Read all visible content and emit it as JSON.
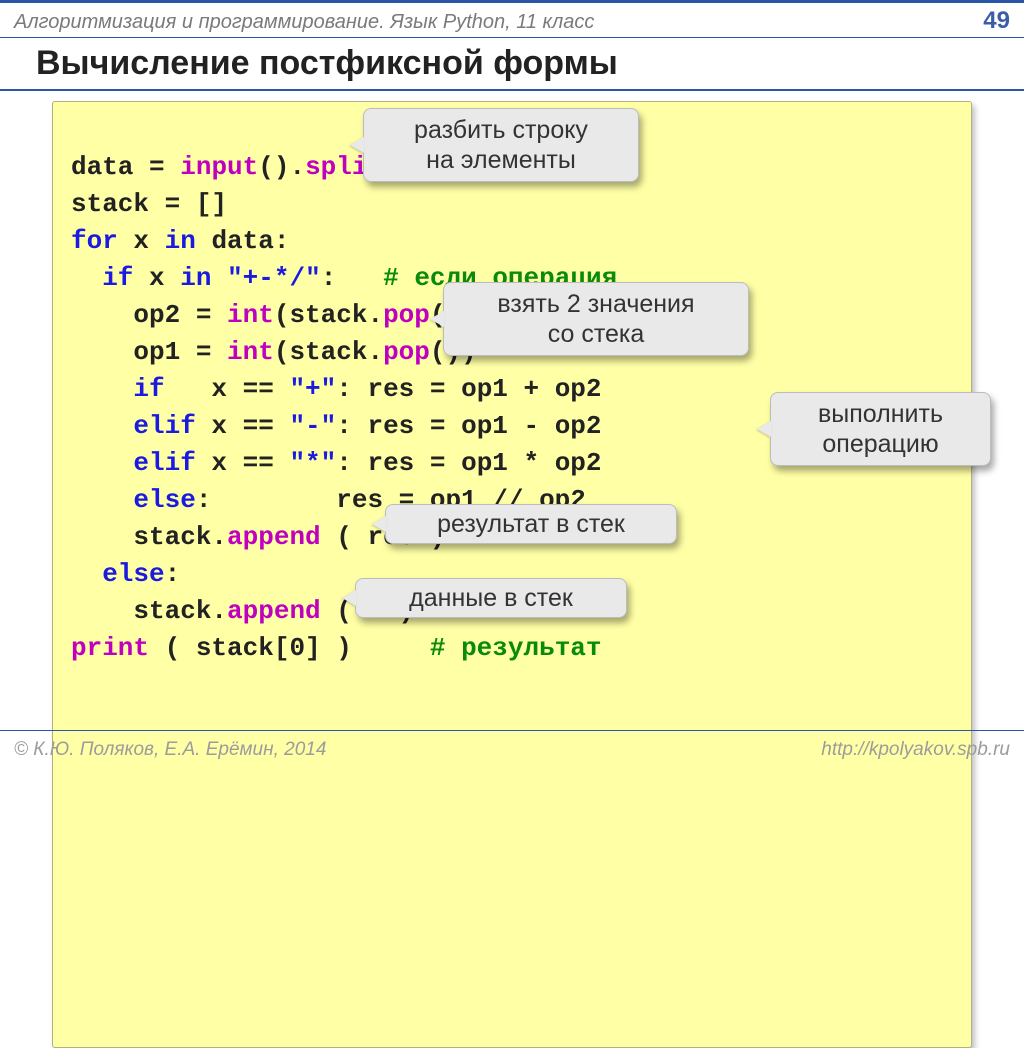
{
  "header": {
    "course": "Алгоритмизация и программирование. Язык Python, 11 класс",
    "page": "49"
  },
  "title": "Вычисление постфиксной формы",
  "code": {
    "l1a": "data",
    "l1b": " = ",
    "l1c": "input",
    "l1d": "().",
    "l1e": "split",
    "l1f": "()",
    "l2": "stack = []",
    "l3a": "for",
    "l3b": " x ",
    "l3c": "in",
    "l3d": " data:",
    "l4a": "  if",
    "l4b": " x ",
    "l4c": "in",
    "l4d": " ",
    "l4e": "\"+-*/\"",
    "l4f": ":   ",
    "l4g": "# если операция",
    "l5a": "    op2 = ",
    "l5b": "int",
    "l5c": "(stack.",
    "l5d": "pop",
    "l5e": "())",
    "l6a": "    op1 = ",
    "l6b": "int",
    "l6c": "(stack.",
    "l6d": "pop",
    "l6e": "())",
    "l7a": "    if",
    "l7b": "   x == ",
    "l7c": "\"+\"",
    "l7d": ": res = op1 + op2",
    "l8a": "    elif",
    "l8b": " x == ",
    "l8c": "\"-\"",
    "l8d": ": res = op1 - op2",
    "l9a": "    elif",
    "l9b": " x == ",
    "l9c": "\"*\"",
    "l9d": ": res = op1 * op2",
    "l10a": "    else",
    "l10b": ":        res = op1 // op2",
    "l11a": "    stack.",
    "l11b": "append",
    "l11c": " ( res )",
    "l12a": "  else",
    "l12b": ":",
    "l13a": "    stack.",
    "l13b": "append",
    "l13c": " ( x )",
    "l14a": "print",
    "l14b": " ( stack[0] )     ",
    "l14c": "# результат"
  },
  "callouts": {
    "split": "разбить строку\nна элементы",
    "pop": "взять 2 значения\nсо стека",
    "operate": "выполнить\nоперацию",
    "push_res": "результат в стек",
    "push_data": "данные в стек"
  },
  "footer": {
    "left": "© К.Ю. Поляков, Е.А. Ерёмин, 2014",
    "right": "http://kpolyakov.spb.ru"
  }
}
